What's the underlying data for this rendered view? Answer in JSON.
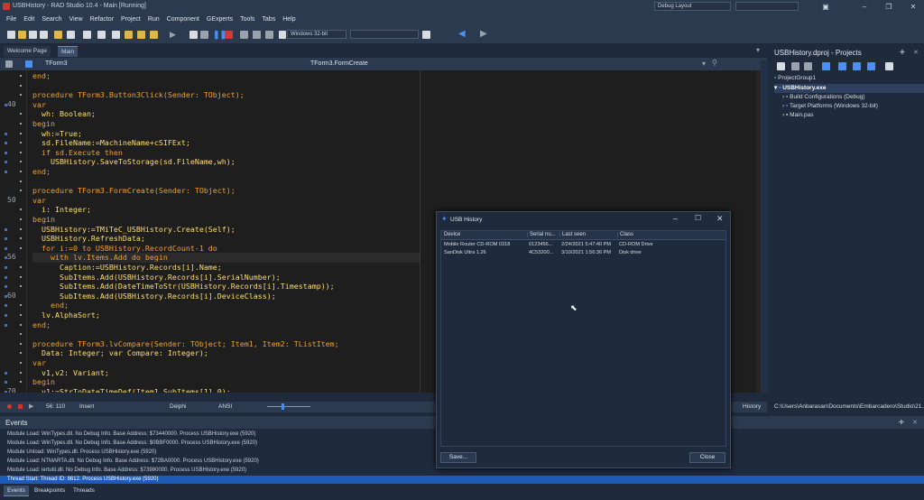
{
  "window": {
    "title": "USBHistory - RAD Studio 10.4 - Main [Running]",
    "layout": "Debug Layout",
    "search_placeholder": ""
  },
  "menu": [
    "File",
    "Edit",
    "Search",
    "View",
    "Refactor",
    "Project",
    "Run",
    "Component",
    "GExperts",
    "Tools",
    "Tabs",
    "Help"
  ],
  "toolbar": {
    "platform": "Windows 32-bit"
  },
  "tabs": [
    "Welcome Page",
    "Main"
  ],
  "editor": {
    "class_combo": "TForm3",
    "method_combo": "TForm3.FormCreate"
  },
  "code_lines": [
    {
      "n": "",
      "t": "end;",
      "c": "k"
    },
    {
      "n": "",
      "t": "",
      "c": "p"
    },
    {
      "n": "",
      "t": "procedure TForm3.Button3Click(Sender: TObject);",
      "c": "k"
    },
    {
      "n": "40",
      "t": "var",
      "c": "k"
    },
    {
      "n": "",
      "t": "  wh: Boolean;",
      "c": "m"
    },
    {
      "n": "",
      "t": "begin",
      "c": "k"
    },
    {
      "n": "",
      "t": "  wh:=True;",
      "c": "m"
    },
    {
      "n": "",
      "t": "  sd.FileName:=MachineName+cSIFExt;",
      "c": "m"
    },
    {
      "n": "",
      "t": "  if sd.Execute then",
      "c": "k"
    },
    {
      "n": "",
      "t": "    USBHistory.SaveToStorage(sd.FileName,wh);",
      "c": "m"
    },
    {
      "n": "",
      "t": "end;",
      "c": "k"
    },
    {
      "n": "",
      "t": "",
      "c": "p"
    },
    {
      "n": "",
      "t": "procedure TForm3.FormCreate(Sender: TObject);",
      "c": "k"
    },
    {
      "n": "50",
      "t": "var",
      "c": "k"
    },
    {
      "n": "",
      "t": "  i: Integer;",
      "c": "m"
    },
    {
      "n": "",
      "t": "begin",
      "c": "k"
    },
    {
      "n": "",
      "t": "  USBHistory:=TMiTeC_USBHistory.Create(Self);",
      "c": "m"
    },
    {
      "n": "",
      "t": "  USBHistory.RefreshData;",
      "c": "m"
    },
    {
      "n": "",
      "t": "  for i:=0 to USBHistory.RecordCount-1 do",
      "c": "k"
    },
    {
      "n": "56",
      "t": "    with lv.Items.Add do begin",
      "c": "k"
    },
    {
      "n": "",
      "t": "      Caption:=USBHistory.Records[i].Name;",
      "c": "m"
    },
    {
      "n": "",
      "t": "      SubItems.Add(USBHistory.Records[i].SerialNumber);",
      "c": "m"
    },
    {
      "n": "",
      "t": "      SubItems.Add(DateTimeToStr(USBHistory.Records[i].Timestamp));",
      "c": "m"
    },
    {
      "n": "60",
      "t": "      SubItems.Add(USBHistory.Records[i].DeviceClass);",
      "c": "m"
    },
    {
      "n": "",
      "t": "    end;",
      "c": "k"
    },
    {
      "n": "",
      "t": "  lv.AlphaSort;",
      "c": "m"
    },
    {
      "n": "",
      "t": "end;",
      "c": "k"
    },
    {
      "n": "",
      "t": "",
      "c": "p"
    },
    {
      "n": "",
      "t": "procedure TForm3.lvCompare(Sender: TObject; Item1, Item2: TListItem;",
      "c": "k"
    },
    {
      "n": "",
      "t": "  Data: Integer; var Compare: Integer);",
      "c": "m"
    },
    {
      "n": "",
      "t": "var",
      "c": "k"
    },
    {
      "n": "",
      "t": "  v1,v2: Variant;",
      "c": "m"
    },
    {
      "n": "",
      "t": "begin",
      "c": "k"
    },
    {
      "n": "70",
      "t": "  v1:=StrToDateTimeDef(Item1.SubItems[1],0);",
      "c": "m"
    }
  ],
  "statusbar": {
    "position": "56: 110",
    "mode": "Insert",
    "language": "Delphi",
    "encoding": "ANSI",
    "history": "History"
  },
  "projects": {
    "title": "USBHistory.dproj - Projects",
    "group": "ProjectGroup1",
    "exe": "USBHistory.exe",
    "build": "Build Configurations (Debug)",
    "target": "Target Platforms (Windows 32-bit)",
    "main": "Main.pas",
    "path": "C:\\Users\\Anbarasan\\Documents\\Embarcadero\\Studio\\21..."
  },
  "events": {
    "title": "Events",
    "lines": [
      "Module Load: WinTypes.dll. No Debug Info. Base Address: $73440000. Process USBHistory.exe (5920)",
      "Module Load: WinTypes.dll. No Debug Info. Base Address: $0BBF0000. Process USBHistory.exe (5920)",
      "Module Unload: WinTypes.dll. Process USBHistory.exe (5920)",
      "Module Load: NTMARTA.dll. No Debug Info. Base Address: $72BA0000. Process USBHistory.exe (5920)",
      "Module Load: iertutil.dll. No Debug Info. Base Address: $73980000. Process USBHistory.exe (5920)",
      "Thread Start: Thread ID: 8612. Process USBHistory.exe (5920)"
    ],
    "tabs": [
      "Events",
      "Breakpoints",
      "Threads"
    ]
  },
  "dialog": {
    "title": "USB History",
    "columns": [
      "Device",
      "Serial nu...",
      "Last seen",
      "Class"
    ],
    "rows": [
      [
        "Mobile Router CD-ROM 0318",
        "0123456...",
        "2/24/2021 5:47:40 PM",
        "CD-ROM Drive"
      ],
      [
        "SanDisk Ultra 1.26",
        "4C53200...",
        "3/10/2021 1:56:36 PM",
        "Disk drive"
      ]
    ],
    "save": "Save...",
    "close": "Close"
  }
}
